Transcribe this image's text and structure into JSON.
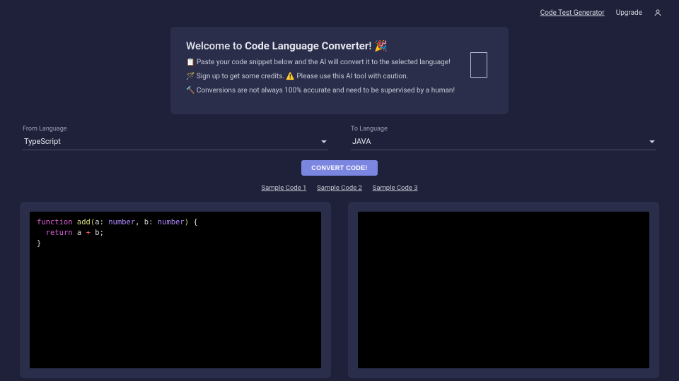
{
  "topbar": {
    "link1": "Code Test Generator",
    "link2": "Upgrade"
  },
  "welcome": {
    "title_prefix": "Welcome to ",
    "title_bold": "Code Language Converter",
    "title_suffix": "! 🎉",
    "line1": "📋 Paste your code snippet below and the AI will convert it to the selected language!",
    "line2": "🪄 Sign up to get some credits. ⚠️ Please use this AI tool with caution.",
    "line3": "🔨 Conversions are not always 100% accurate and need to be supervised by a human!"
  },
  "selects": {
    "from_label": "From Language",
    "from_value": "TypeScript",
    "to_label": "To Language",
    "to_value": "JAVA"
  },
  "buttons": {
    "convert": "CONVERT CODE!"
  },
  "samples": {
    "s1": "Sample Code 1",
    "s2": "Sample Code 2",
    "s3": "Sample Code 3"
  },
  "code": {
    "kw_function": "function",
    "fn_name": "add",
    "param_a": "a",
    "param_b": "b",
    "type_number": "number",
    "kw_return": "return",
    "body_expr_a": "a",
    "body_expr_b": "b"
  }
}
